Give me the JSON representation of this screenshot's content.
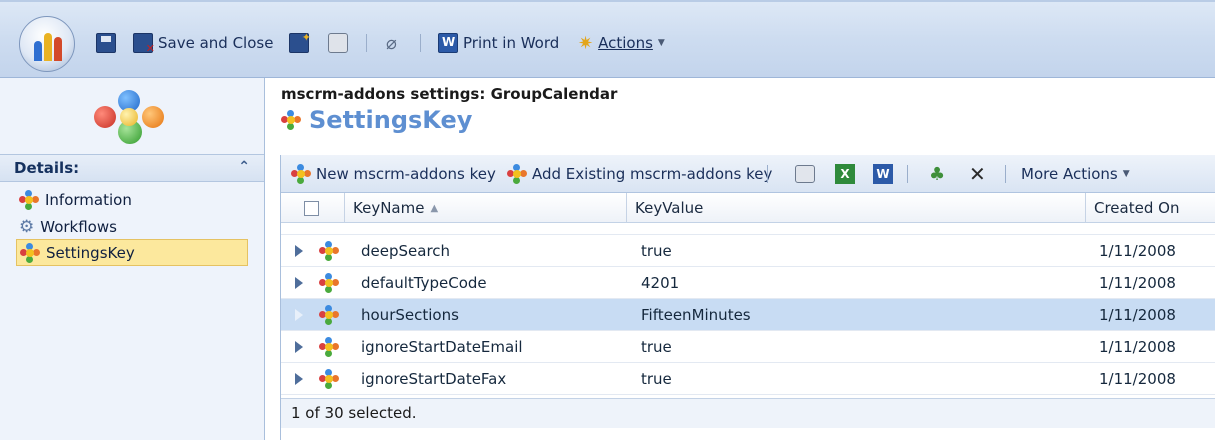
{
  "toolbar": {
    "save_and_close": "Save and Close",
    "print_in_word": "Print in Word",
    "actions": "Actions"
  },
  "left": {
    "details_label": "Details:",
    "nav": [
      {
        "label": "Information",
        "icon": "gear-icon"
      },
      {
        "label": "Workflows",
        "icon": "workflow-icon"
      },
      {
        "label": "SettingsKey",
        "icon": "gear-icon",
        "selected": true
      }
    ]
  },
  "header": {
    "breadcrumb": "mscrm-addons settings: GroupCalendar",
    "title": "SettingsKey"
  },
  "grid": {
    "toolbar": {
      "new_key": "New mscrm-addons key",
      "add_existing": "Add Existing mscrm-addons key",
      "more_actions": "More Actions"
    },
    "columns": {
      "keyname": "KeyName",
      "keyvalue": "KeyValue",
      "created": "Created On"
    },
    "rows": [
      {
        "key": "deepSearch",
        "value": "true",
        "date": "1/11/2008"
      },
      {
        "key": "defaultTypeCode",
        "value": "4201",
        "date": "1/11/2008"
      },
      {
        "key": "hourSections",
        "value": "FifteenMinutes",
        "date": "1/11/2008",
        "selected": true
      },
      {
        "key": "ignoreStartDateEmail",
        "value": "true",
        "date": "1/11/2008"
      },
      {
        "key": "ignoreStartDateFax",
        "value": "true",
        "date": "1/11/2008"
      }
    ],
    "footer": "1 of 30 selected."
  },
  "colors": {
    "selection": "#c8dcf3",
    "nav_selected": "#fce89d",
    "title": "#5e8fd1"
  }
}
